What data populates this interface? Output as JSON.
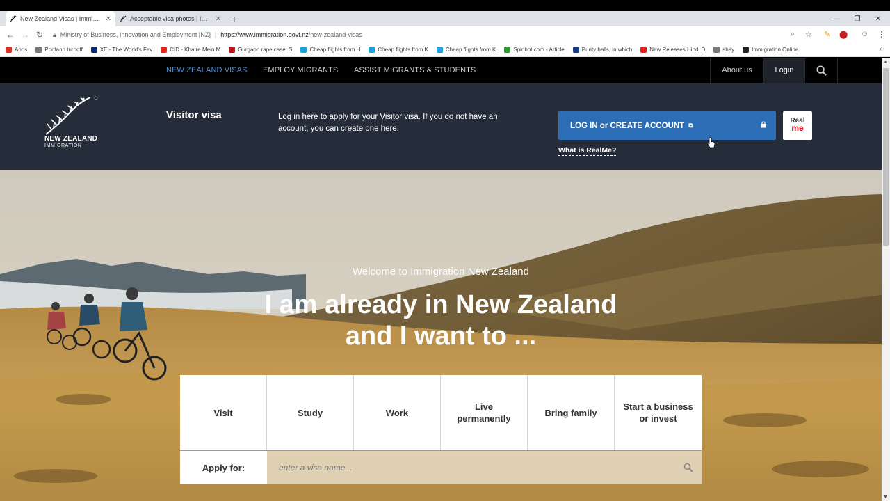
{
  "browser": {
    "tabs": [
      {
        "title": "New Zealand Visas | Immigratio",
        "active": true
      },
      {
        "title": "Acceptable visa photos | Immigr",
        "active": false
      }
    ],
    "new_tab": "+",
    "omnibox": {
      "org": "Ministry of Business, Innovation and Employment [NZ]",
      "url_host": "https://www.immigration.govt.nz",
      "url_path": "/new-zealand-visas"
    },
    "bookmarks": [
      {
        "label": "Apps",
        "icon": "apps-grid-icon",
        "color": "#d93025"
      },
      {
        "label": "Portland turnoff",
        "icon": "page-icon",
        "color": "#777777"
      },
      {
        "label": "XE - The World's Fav",
        "icon": "xe-icon",
        "color": "#0b2a6f"
      },
      {
        "label": "CID - Khatre Mein M",
        "icon": "youtube-icon",
        "color": "#e62117"
      },
      {
        "label": "Gurgaon rape case: S",
        "icon": "news-icon",
        "color": "#c4161c"
      },
      {
        "label": "Cheap flights from H",
        "icon": "flight-icon",
        "color": "#1fa0d8"
      },
      {
        "label": "Cheap flights from K",
        "icon": "flight-icon",
        "color": "#1fa0d8"
      },
      {
        "label": "Cheap flights from K",
        "icon": "flight-icon",
        "color": "#1fa0d8"
      },
      {
        "label": "Spinbot.com - Article",
        "icon": "spinbot-icon",
        "color": "#2aa12a"
      },
      {
        "label": "Purity balls, in which",
        "icon": "m-icon",
        "color": "#1a3e8c"
      },
      {
        "label": "New Releases Hindi D",
        "icon": "youtube-icon",
        "color": "#e62117"
      },
      {
        "label": "shay",
        "icon": "page-icon",
        "color": "#777777"
      },
      {
        "label": "Immigration Online",
        "icon": "fern-icon",
        "color": "#222222"
      }
    ]
  },
  "nav": {
    "links": [
      "NEW ZEALAND VISAS",
      "EMPLOY MIGRANTS",
      "ASSIST MIGRANTS & STUDENTS"
    ],
    "about": "About us",
    "login": "Login"
  },
  "logo": {
    "line1": "NEW ZEALAND",
    "line2": "IMMIGRATION"
  },
  "banner": {
    "title": "Visitor visa",
    "description": "Log in here to apply for your Visitor visa. If you do not have an account, you can create one here.",
    "login_button": "LOG IN or CREATE ACCOUNT",
    "realme_line1": "Real",
    "realme_line2": "me",
    "what_is_realme": "What is RealMe?"
  },
  "hero": {
    "welcome": "Welcome to Immigration New Zealand",
    "headline_line1": "I am already in New Zealand",
    "headline_line2": "and I want to ...",
    "choices": [
      "Visit",
      "Study",
      "Work",
      "Live permanently",
      "Bring family",
      "Start a business or invest"
    ],
    "apply_label": "Apply for:",
    "apply_placeholder": "enter a visa name..."
  },
  "colors": {
    "nav_active": "#4c8fd6",
    "banner_bg": "#262d3a",
    "login_button": "#2d6fb7",
    "realme_red": "#e2001a"
  }
}
